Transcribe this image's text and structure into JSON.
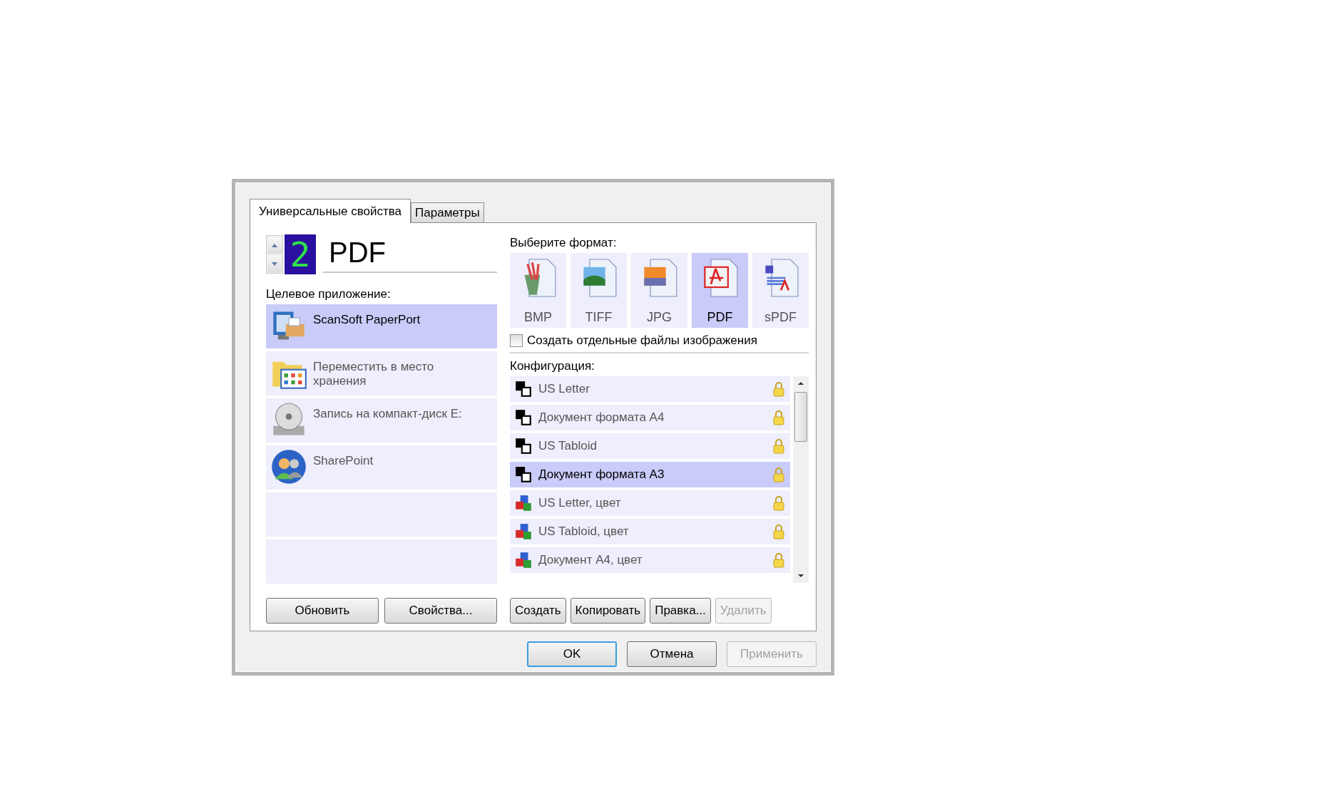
{
  "tabs": [
    {
      "label": "Универсальные свойства",
      "selected": true
    },
    {
      "label": "Параметры",
      "selected": false
    }
  ],
  "counter": {
    "value": "2"
  },
  "format_name": "PDF",
  "target_label": "Целевое приложение:",
  "applications": [
    {
      "kind": "paperport",
      "label": "ScanSoft PaperPort",
      "selected": true
    },
    {
      "kind": "folder",
      "label": "Переместить в место хранения",
      "selected": false
    },
    {
      "kind": "cd",
      "label": "Запись на компакт-диск  E:",
      "selected": false
    },
    {
      "kind": "people",
      "label": "SharePoint",
      "selected": false
    }
  ],
  "app_buttons": [
    {
      "label": "Обновить",
      "disabled": false
    },
    {
      "label": "Свойства...",
      "disabled": false
    }
  ],
  "format_label": "Выберите формат:",
  "formats": [
    {
      "kind": "bmp",
      "label": "BMP",
      "selected": false
    },
    {
      "kind": "tiff",
      "label": "TIFF",
      "selected": false
    },
    {
      "kind": "jpg",
      "label": "JPG",
      "selected": false
    },
    {
      "kind": "pdf",
      "label": "PDF",
      "selected": true
    },
    {
      "kind": "spdf",
      "label": "sPDF",
      "selected": false
    }
  ],
  "separate_files": {
    "label": "Создать отдельные файлы изображения",
    "checked": false
  },
  "config_label": "Конфигурация:",
  "configurations": [
    {
      "kind": "bw",
      "label": "US Letter",
      "locked": true,
      "selected": false
    },
    {
      "kind": "bw",
      "label": "Документ формата А4",
      "locked": true,
      "selected": false
    },
    {
      "kind": "bw",
      "label": "US Tabloid",
      "locked": true,
      "selected": false
    },
    {
      "kind": "bw",
      "label": "Документ формата А3",
      "locked": true,
      "selected": true
    },
    {
      "kind": "color",
      "label": "US Letter, цвет",
      "locked": true,
      "selected": false
    },
    {
      "kind": "color",
      "label": "US Tabloid, цвет",
      "locked": true,
      "selected": false
    },
    {
      "kind": "color",
      "label": "Документ А4, цвет",
      "locked": true,
      "selected": false
    }
  ],
  "config_buttons": [
    {
      "label": "Создать",
      "disabled": false
    },
    {
      "label": "Копировать",
      "disabled": false
    },
    {
      "label": "Правка...",
      "disabled": false
    },
    {
      "label": "Удалить",
      "disabled": true
    }
  ],
  "dialog_buttons": [
    {
      "label": "OK",
      "default": true,
      "disabled": false
    },
    {
      "label": "Отмена",
      "default": false,
      "disabled": false
    },
    {
      "label": "Применить",
      "default": false,
      "disabled": true
    }
  ]
}
